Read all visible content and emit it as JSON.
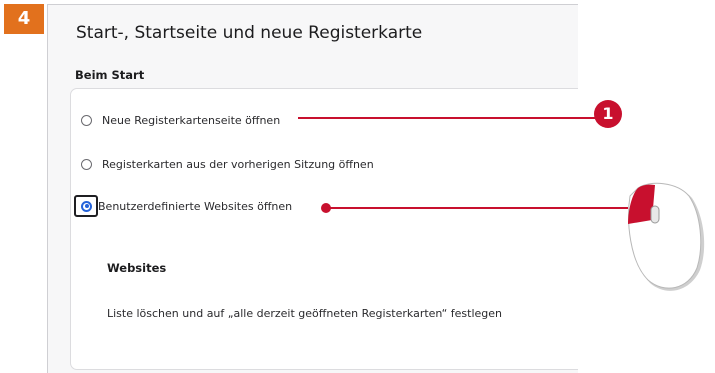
{
  "step": "4",
  "panel": {
    "title": "Start-, Startseite und neue Registerkarte",
    "group_label": "Beim Start",
    "options": [
      {
        "label": "Neue Registerkartenseite öffnen",
        "selected": false
      },
      {
        "label": "Registerkarten aus der vorherigen Sitzung öffnen",
        "selected": false
      },
      {
        "label": "Benutzerdefinierte Websites öffnen",
        "selected": true
      }
    ],
    "websites_heading": "Websites",
    "websites_action": "Liste löschen und auf „alle derzeit geöffneten Registerkarten“ festlegen"
  },
  "callout": {
    "number": "1"
  },
  "icons": [
    "mouse-left-click-icon"
  ],
  "colors": {
    "accent": "#2563d9",
    "callout": "#c8102e",
    "step_badge": "#e2711d"
  }
}
